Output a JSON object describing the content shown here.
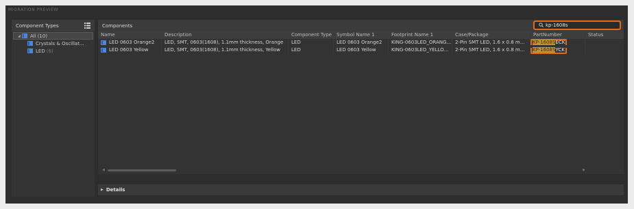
{
  "app_title": "MIGRATION PREVIEW",
  "left_panel": {
    "title": "Component Types",
    "tree": [
      {
        "label": "All",
        "count": "(10)",
        "selected": true
      },
      {
        "label": "Crystals & Oscillat...",
        "count": ""
      },
      {
        "label": "LED",
        "count": "(6)"
      }
    ]
  },
  "components": {
    "title": "Components",
    "search_value": "kp-1608s",
    "columns": [
      "Name",
      "Description",
      "Component Type",
      "Symbol Name 1",
      "Footprint Name 1",
      "Case/Package",
      "PartNumber",
      "Status"
    ],
    "rows": [
      {
        "name": "LED 0603 Orange2",
        "description": "LED, SMT, 0603(1608), 1.1mm thickness, Orange",
        "type": "LED",
        "symbol": "LED 0603 Orange2",
        "footprint": "KING-0603LED_ORANG...",
        "case": "2-Pin SMT LED, 1.6 x 0.8 m...",
        "part_highlight": "KP-1608S",
        "part_rest": "ECK",
        "status": ""
      },
      {
        "name": "LED 0603 Yellow",
        "description": "LED, SMT, 0603(1608), 1.1mm thickness, Yellow",
        "type": "LED",
        "symbol": "LED 0603 Yellow",
        "footprint": "KING-0603LED_YELLOW...",
        "case": "2-Pin SMT LED, 1.6 x 0.8 m...",
        "part_highlight": "KP-1608S",
        "part_rest": "YCK",
        "status": ""
      }
    ]
  },
  "details_label": "Details",
  "colors": {
    "accent": "#e06c1a",
    "highlight": "#c59531",
    "icon_blue": "#4b86d8"
  }
}
